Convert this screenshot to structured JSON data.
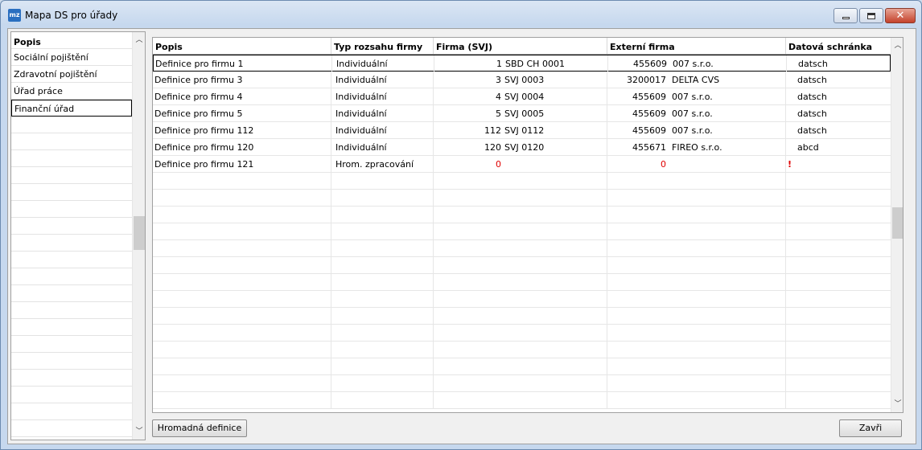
{
  "window": {
    "title": "Mapa DS pro úřady",
    "app_icon_text": "mz"
  },
  "left_list": {
    "header": "Popis",
    "items": [
      {
        "label": "Sociální pojištění"
      },
      {
        "label": "Zdravotní pojištění"
      },
      {
        "label": "Úřad práce"
      },
      {
        "label": "Finanční úřad",
        "selected": true
      }
    ]
  },
  "grid": {
    "columns": [
      "Popis",
      "Typ rozsahu firmy",
      "Firma (SVJ)",
      "Externí firma",
      "Datová schránka"
    ],
    "rows": [
      {
        "popis": "Definice pro firmu 1",
        "typ": "Individuální",
        "firma_num": "1",
        "firma_name": "SBD CH 0001",
        "ext_num": "455609",
        "ext_name": "007 s.r.o.",
        "ds": "datsch",
        "selected": true
      },
      {
        "popis": "Definice pro firmu 3",
        "typ": "Individuální",
        "firma_num": "3",
        "firma_name": "SVJ 0003",
        "ext_num": "3200017",
        "ext_name": "DELTA CVS",
        "ds": "datsch"
      },
      {
        "popis": "Definice pro firmu 4",
        "typ": "Individuální",
        "firma_num": "4",
        "firma_name": "SVJ 0004",
        "ext_num": "455609",
        "ext_name": "007 s.r.o.",
        "ds": "datsch"
      },
      {
        "popis": "Definice pro firmu 5",
        "typ": "Individuální",
        "firma_num": "5",
        "firma_name": "SVJ 0005",
        "ext_num": "455609",
        "ext_name": "007 s.r.o.",
        "ds": "datsch"
      },
      {
        "popis": "Definice pro firmu 112",
        "typ": "Individuální",
        "firma_num": "112",
        "firma_name": "SVJ 0112",
        "ext_num": "455609",
        "ext_name": "007 s.r.o.",
        "ds": "datsch"
      },
      {
        "popis": "Definice pro firmu 120",
        "typ": "Individuální",
        "firma_num": "120",
        "firma_name": "SVJ 0120",
        "ext_num": "455671",
        "ext_name": "FIREO  s.r.o.",
        "ds": "abcd"
      },
      {
        "popis": "Definice pro firmu 121",
        "typ": "Hrom. zpracování",
        "firma_num": "0",
        "firma_name": "",
        "ext_num": "0",
        "ext_name": "",
        "ds": "!",
        "warning": true
      }
    ]
  },
  "buttons": {
    "bulk_definition": "Hromadná definice",
    "close": "Zavři"
  },
  "colors": {
    "warning": "#e00000",
    "selection_border": "#000000"
  }
}
